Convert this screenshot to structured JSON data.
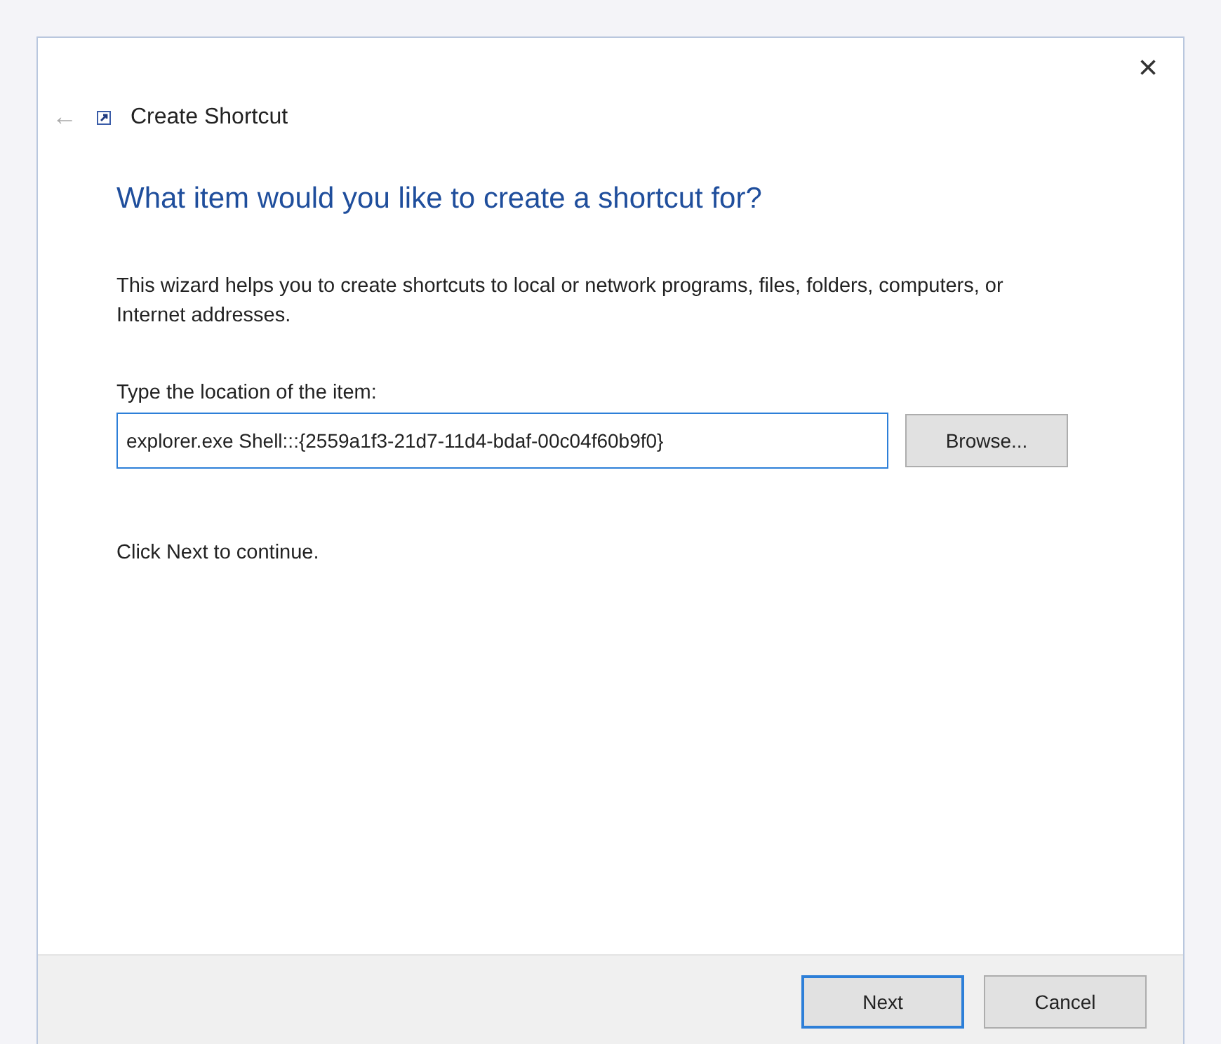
{
  "window": {
    "title": "Create Shortcut",
    "close": "×",
    "back": "←"
  },
  "heading": "What item would you like to create a shortcut for?",
  "intro": "This wizard helps you to create shortcuts to local or network programs, files, folders, computers, or Internet addresses.",
  "location": {
    "label": "Type the location of the item:",
    "value": "explorer.exe Shell:::{2559a1f3-21d7-11d4-bdaf-00c04f60b9f0}"
  },
  "browse": "Browse...",
  "hint": "Click Next to continue.",
  "buttons": [
    {
      "label": "Next",
      "default": true
    },
    {
      "label": "Cancel",
      "default": false
    }
  ]
}
